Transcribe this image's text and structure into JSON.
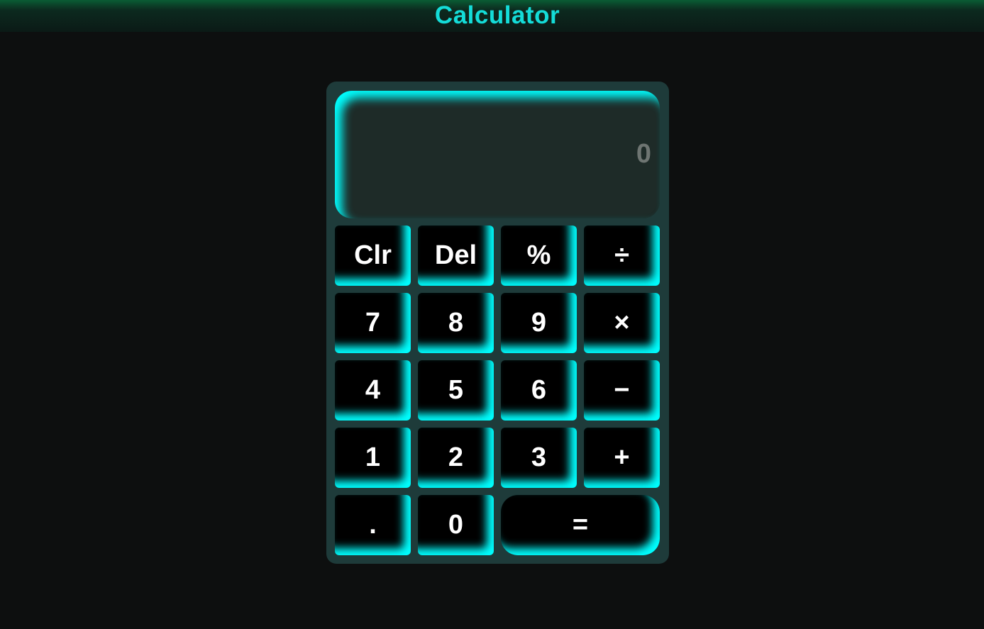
{
  "app": {
    "title": "Calculator"
  },
  "display": {
    "value": "0"
  },
  "keys": {
    "clear": "Clr",
    "delete": "Del",
    "percent": "%",
    "divide": "÷",
    "seven": "7",
    "eight": "8",
    "nine": "9",
    "multiply": "×",
    "four": "4",
    "five": "5",
    "six": "6",
    "subtract": "−",
    "one": "1",
    "two": "2",
    "three": "3",
    "add": "+",
    "decimal": ".",
    "zero": "0",
    "equals": "="
  },
  "colors": {
    "accent": "#00ffff",
    "title": "#14dcd8",
    "background": "#0d0f0f",
    "body": "#1e3b3a",
    "display": "#1e2b28",
    "key": "#000000"
  }
}
